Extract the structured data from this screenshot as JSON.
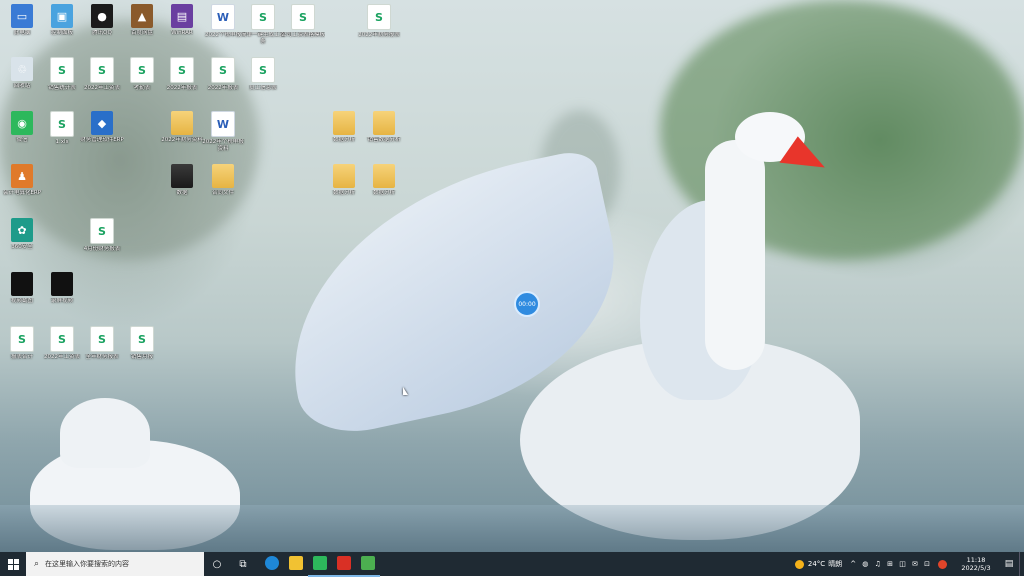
{
  "desktop": {
    "icons": [
      {
        "label": "此电脑",
        "kind": "pc",
        "glyph": "▭"
      },
      {
        "label": "控制面板",
        "kind": "ctrl",
        "glyph": "▣"
      },
      {
        "label": "腾讯QQ",
        "kind": "qq",
        "glyph": "●"
      },
      {
        "label": "百度网盘",
        "kind": "game",
        "glyph": "▲"
      },
      {
        "label": "WinRAR",
        "kind": "rar",
        "glyph": "▤"
      },
      {
        "label": "2022个税申报",
        "kind": "word",
        "glyph": "W"
      },
      {
        "label": "简单一键生成工资条",
        "kind": "sheet",
        "glyph": "S"
      },
      {
        "label": "公司工资表格模板",
        "kind": "sheet",
        "glyph": "S"
      },
      {
        "label": "2022年财务报表",
        "kind": "sheet",
        "glyph": "S"
      },
      {
        "label": "回收站",
        "kind": "bin",
        "glyph": "♲"
      },
      {
        "label": "销售统计表",
        "kind": "sheet",
        "glyph": "S"
      },
      {
        "label": "2022年工资表",
        "kind": "sheet",
        "glyph": "S"
      },
      {
        "label": "考勤表",
        "kind": "sheet",
        "glyph": "S"
      },
      {
        "label": "2022年报表",
        "kind": "sheet",
        "glyph": "S"
      },
      {
        "label": "2022年报表",
        "kind": "sheet",
        "glyph": "S"
      },
      {
        "label": "员工信息表",
        "kind": "sheet",
        "glyph": "S"
      },
      {
        "label": "微信",
        "kind": "wechat",
        "glyph": "◉"
      },
      {
        "label": "1.xls",
        "kind": "sheet",
        "glyph": "S"
      },
      {
        "label": "财务管理软件ERP",
        "kind": "erp",
        "glyph": "◆"
      },
      {
        "label": "2022年财务资料",
        "kind": "folder",
        "glyph": ""
      },
      {
        "label": "2022年个税申报资料",
        "kind": "word",
        "glyph": "W"
      },
      {
        "label": "数据分析",
        "kind": "folder",
        "glyph": ""
      },
      {
        "label": "销售数据分析",
        "kind": "folder",
        "glyph": ""
      },
      {
        "label": "会计电算化ERP",
        "kind": "erp2",
        "glyph": "♟"
      },
      {
        "label": "数据",
        "kind": "folder-dark",
        "glyph": ""
      },
      {
        "label": "合同文件",
        "kind": "folder",
        "glyph": ""
      },
      {
        "label": "数据分析",
        "kind": "folder",
        "glyph": ""
      },
      {
        "label": "数据分析",
        "kind": "folder",
        "glyph": ""
      },
      {
        "label": "360安全",
        "kind": "sec",
        "glyph": "✿"
      },
      {
        "label": "4月份财务报表",
        "kind": "sheet",
        "glyph": "S"
      },
      {
        "label": "视频截图",
        "kind": "thumb",
        "glyph": ""
      },
      {
        "label": "录屏视频",
        "kind": "thumb",
        "glyph": ""
      },
      {
        "label": "报表合计",
        "kind": "sheet",
        "glyph": "S"
      },
      {
        "label": "2022年工资表",
        "kind": "sheet",
        "glyph": "S"
      },
      {
        "label": "全年财务报表",
        "kind": "sheet",
        "glyph": "S"
      },
      {
        "label": "销售月报",
        "kind": "sheet",
        "glyph": "S"
      }
    ],
    "timer_text": "00:00"
  },
  "taskbar": {
    "start_icon": "windows-logo",
    "search_placeholder": "在这里输入你要搜索的内容",
    "search_glyph": "⌕",
    "cortana_glyph": "○",
    "taskview_glyph": "⧉",
    "apps": [
      {
        "name": "edge",
        "color": "#1e88d8"
      },
      {
        "name": "file-explorer",
        "color": "#f1c232"
      },
      {
        "name": "wechat",
        "color": "#2db85c"
      },
      {
        "name": "wps",
        "color": "#d93025"
      },
      {
        "name": "active-app",
        "color": "#4caf50"
      }
    ],
    "weather": {
      "temp": "24°C",
      "desc": "晴朗"
    },
    "tray_glyphs": "^ ◍ ♫ ⊞ ◫ ✉ ⊡",
    "time": "11:18",
    "date": "2022/5/3",
    "notification_glyph": "▤"
  }
}
